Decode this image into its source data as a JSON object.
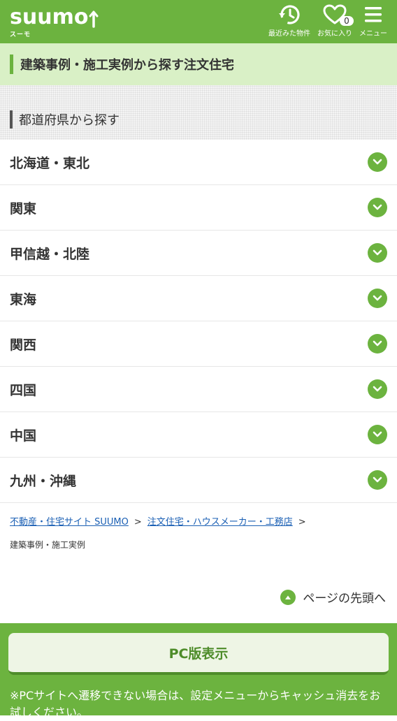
{
  "header": {
    "logo_text": "suumo",
    "logo_sub": "スーモ",
    "recent_label": "最近みた物件",
    "favorites_label": "お気に入り",
    "favorites_count": "0",
    "menu_label": "メニュー"
  },
  "page_title": "建築事例・施工実例から探す注文住宅",
  "section_title": "都道府県から探す",
  "regions": [
    {
      "label": "北海道・東北"
    },
    {
      "label": "関東"
    },
    {
      "label": "甲信越・北陸"
    },
    {
      "label": "東海"
    },
    {
      "label": "関西"
    },
    {
      "label": "四国"
    },
    {
      "label": "中国"
    },
    {
      "label": "九州・沖縄"
    }
  ],
  "breadcrumb": {
    "link1": "不動産・住宅サイト SUUMO",
    "link2": "注文住宅・ハウスメーカー・工務店",
    "separator": ">",
    "current": "建築事例・施工実例"
  },
  "to_top_label": "ページの先頭へ",
  "footer": {
    "pc_button": "PC版表示",
    "note": "※PCサイトへ遷移できない場合は、設定メニューからキャッシュ消去をお試しください。"
  },
  "colors": {
    "brand_green": "#6cb33f",
    "light_green": "#d9f0c6",
    "link_blue": "#1a5fb4"
  }
}
